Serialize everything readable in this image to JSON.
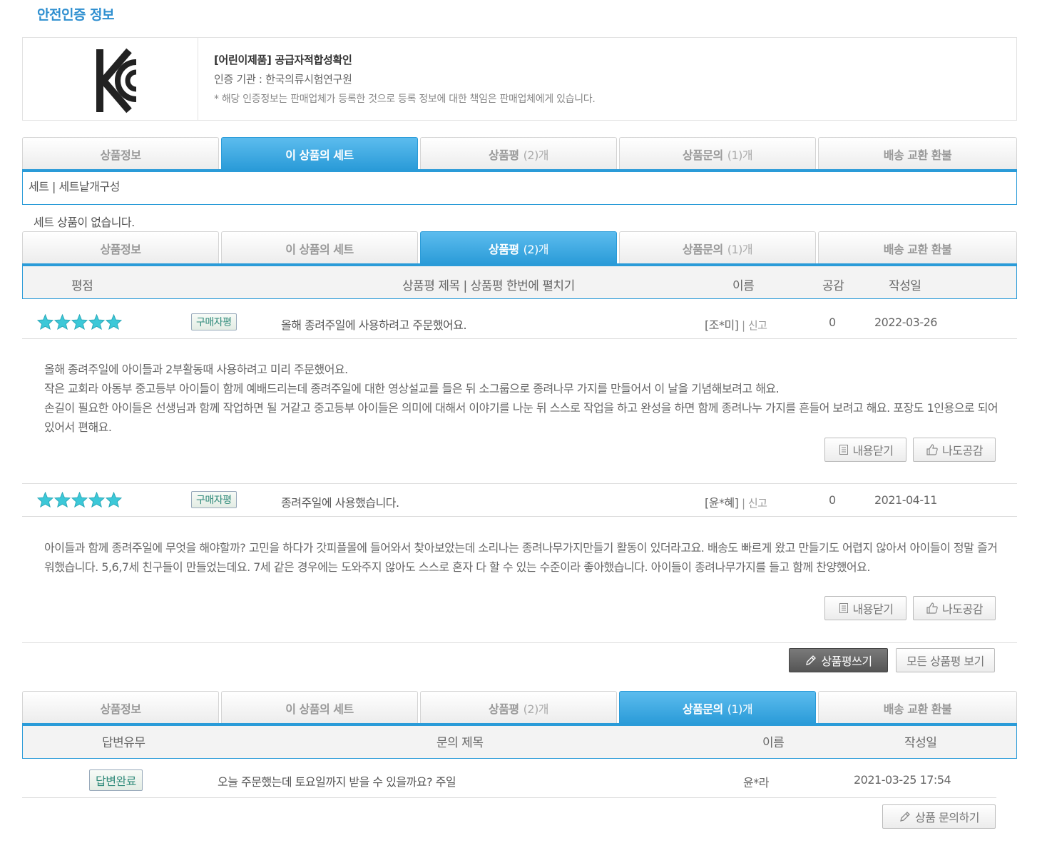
{
  "safety": {
    "title": "안전인증 정보",
    "cert_name": "[어린이제품] 공급자적합성확인",
    "cert_org": "인증 기관 : 한국의류시험연구원",
    "note": "* 해당 인증정보는 판매업체가 등록한 것으로 등록 정보에 대한 책임은 판매업체에게 있습니다."
  },
  "tabs": [
    {
      "label": "상품정보",
      "count": ""
    },
    {
      "label": "이 상품의 세트",
      "count": ""
    },
    {
      "label": "상품평",
      "count": "(2)개"
    },
    {
      "label": "상품문의",
      "count": "(1)개"
    },
    {
      "label": "배송 교환 환불",
      "count": ""
    }
  ],
  "set_section": {
    "path": "세트 | 세트낱개구성",
    "empty": "세트 상품이 없습니다."
  },
  "review_header": {
    "rating": "평점",
    "title": "상품평 제목 | 상품평 한번에 펼치기",
    "name": "이름",
    "like": "공감",
    "date": "작성일"
  },
  "reviews": [
    {
      "badge": "구매자평",
      "title": "올해 종려주일에 사용하려고 주문했어요.",
      "author": "[조*미]",
      "report": "신고",
      "likes": "0",
      "date": "2022-03-26",
      "body": [
        "올해 종려주일에 아이들과 2부활동때 사용하려고 미리 주문했어요.",
        "작은 교회라 아동부 중고등부 아이들이 함께 예배드리는데 종려주일에 대한 영상설교를 들은 뒤 소그룹으로 종려나무 가지를 만들어서 이 날을 기념해보려고 해요.",
        "손길이 필요한 아이들은 선생님과 함께 작업하면 될 거같고 중고등부 아이들은 의미에 대해서 이야기를 나눈 뒤 스스로 작업을 하고 완성을 하면 함께 종려나누 가지를 흔들어 보려고 해요. 포장도 1인용으로 되어 있어서 편해요."
      ],
      "close_label": "내용닫기",
      "like_label": "나도공감"
    },
    {
      "badge": "구매자평",
      "title": "종려주일에 사용했습니다.",
      "author": "[윤*혜]",
      "report": "신고",
      "likes": "0",
      "date": "2021-04-11",
      "body": [
        "아이들과 함께 종려주일에 무엇을 해야할까? 고민을 하다가 갓피플몰에 들어와서 찾아보았는데 소리나는 종려나무가지만들기 활동이 있더라고요. 배송도 빠르게 왔고 만들기도 어렵지 않아서 아이들이 정말 즐거워했습니다. 5,6,7세 친구들이 만들었는데요. 7세 같은 경우에는 도와주지 않아도 스스로 혼자 다 할 수 있는 수준이라 좋아했습니다. 아이들이 종려나무가지를 들고 함께 찬양했어요."
      ],
      "close_label": "내용닫기",
      "like_label": "나도공감"
    }
  ],
  "review_actions": {
    "write": "상품평쓰기",
    "all": "모든 상품평 보기"
  },
  "qna_header": {
    "status": "답변유무",
    "title": "문의 제목",
    "name": "이름",
    "date": "작성일"
  },
  "qna": [
    {
      "status": "답변완료",
      "title": "오늘 주문했는데 토요일까지 받을 수 있을까요? 주일",
      "name": "윤*라",
      "date": "2021-03-25 17:54"
    }
  ],
  "qna_action": "상품 문의하기",
  "colors": {
    "accent": "#2a9bd8",
    "star": "#3cc8d8",
    "badge_text": "#2f8a7a"
  }
}
